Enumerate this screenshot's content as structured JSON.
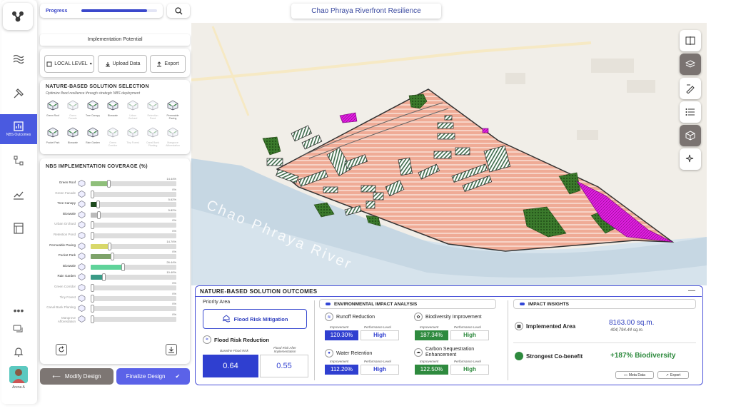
{
  "header": {
    "progress_label": "Progress",
    "progress_value": 0.87,
    "title": "Chao Phraya Riverfront Resilience"
  },
  "nav": {
    "active_label": "NBS Outcomes",
    "user_name": "Arena A"
  },
  "left": {
    "implementation_title": "Implementation Potential",
    "level_label": "LOCAL LEVEL",
    "upload_label": "Upload Data",
    "export_label": "Export",
    "selection_title": "NATURE-BASED SOLUTION SELECTION",
    "selection_subtitle": "Optimize flood resilience through strategic NBS deployment",
    "nbs_items": [
      {
        "label": "Green Roof",
        "dim": false
      },
      {
        "label": "Green Facade",
        "dim": true
      },
      {
        "label": "Tree Canopy",
        "dim": false
      },
      {
        "label": "Bioswale",
        "dim": false
      },
      {
        "label": "Urban Orchard",
        "dim": true
      },
      {
        "label": "Retention Pond",
        "dim": true
      },
      {
        "label": "Permeable Paving",
        "dim": false
      },
      {
        "label": "Pocket Park",
        "dim": false
      },
      {
        "label": "Bioswale",
        "dim": false
      },
      {
        "label": "Rain Garden",
        "dim": false
      },
      {
        "label": "Green Corridor",
        "dim": true
      },
      {
        "label": "Tiny Forest",
        "dim": true
      },
      {
        "label": "Canal Bank Planting",
        "dim": true
      },
      {
        "label": "Mangrove Afforestation",
        "dim": true
      }
    ],
    "coverage_title": "NBS IMPLEMENTATION COVERAGE (%)",
    "coverage": [
      {
        "label": "Green Roof",
        "pct": "14.44%",
        "value": 0.14,
        "color": "#8fbf7a",
        "dim": false
      },
      {
        "label": "Green Facade",
        "pct": "0%",
        "value": 0,
        "color": "#ccc",
        "dim": true
      },
      {
        "label": "Tree Canopy",
        "pct": "5.62%",
        "value": 0.056,
        "color": "#1d4a1d",
        "dim": false
      },
      {
        "label": "Bioswale",
        "pct": "5.82%",
        "value": 0.058,
        "color": "#bbb",
        "dim": false
      },
      {
        "label": "Urban Orchard",
        "pct": "0%",
        "value": 0,
        "color": "#ccc",
        "dim": true
      },
      {
        "label": "Retention Pond",
        "pct": "0%",
        "value": 0,
        "color": "#ccc",
        "dim": true
      },
      {
        "label": "Permeable Paving",
        "pct": "14.70%",
        "value": 0.147,
        "color": "#d8d86a",
        "dim": false
      },
      {
        "label": "Pocket Park",
        "pct": "0%",
        "value": 0.17,
        "color": "#7ea36a",
        "dim": false
      },
      {
        "label": "Bioswale",
        "pct": "26.44%",
        "value": 0.264,
        "color": "#5fd39a",
        "dim": false
      },
      {
        "label": "Rain Garden",
        "pct": "10.40%",
        "value": 0.104,
        "color": "#3a9a86",
        "dim": false
      },
      {
        "label": "Green Corridor",
        "pct": "0%",
        "value": 0,
        "color": "#ccc",
        "dim": true
      },
      {
        "label": "Tiny Forest",
        "pct": "0%",
        "value": 0,
        "color": "#ccc",
        "dim": true
      },
      {
        "label": "Canal Bank Planting",
        "pct": "0%",
        "value": 0,
        "color": "#ccc",
        "dim": true
      },
      {
        "label": "Mangrove Afforestation",
        "pct": "0%",
        "value": 0,
        "color": "#ccc",
        "dim": true
      }
    ],
    "modify_label": "Modify Design",
    "finalize_label": "Finalize Design"
  },
  "map": {
    "river_label": "Chao Phraya River"
  },
  "outcomes": {
    "title": "NATURE-BASED SOLUTION OUTCOMES",
    "priority_label": "Priority Area",
    "priority_value": "Flood Risk Mitigation",
    "reduction_title": "Flood Risk Reduction",
    "baseline_label": "Baseline Flood Risk",
    "after_label": "Flood Risk After Implementation",
    "baseline_value": "0.64",
    "after_value": "0.55",
    "env_title": "ENVIRONMENTAL IMPACT ANALYSIS",
    "improvement_label": "Improvement",
    "performance_label": "Performance Level",
    "metrics": [
      {
        "name": "Runoff Reduction",
        "improvement": "120.30%",
        "level": "High"
      },
      {
        "name": "Water Retention",
        "improvement": "112.20%",
        "level": "High"
      },
      {
        "name": "Biodiversity Improvement",
        "improvement": "187.34%",
        "level": "High"
      },
      {
        "name": "Carbon Sequestration Enhancement",
        "improvement": "122.50%",
        "level": "High"
      }
    ],
    "insights_title": "IMPACT INSIGHTS",
    "area_label": "Implemented Area",
    "area_value": "8163.00 sq.m.",
    "area_sub": "404,794.44 sq.m.",
    "cobenefit_label": "Strongest Co-benefit",
    "cobenefit_value": "+187% Biodiversity",
    "meta_label": "Meta Data",
    "export_label": "Export"
  }
}
